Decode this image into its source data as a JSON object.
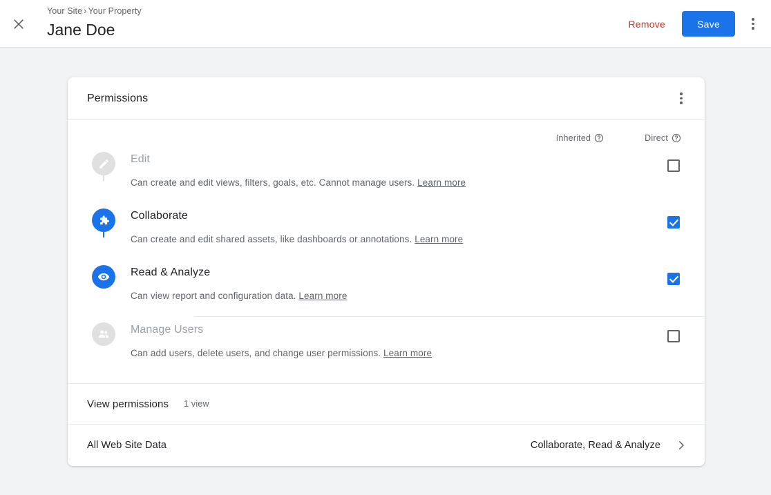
{
  "topbar": {
    "close_icon": "close-icon",
    "breadcrumb": {
      "account": "Your Site",
      "separator": "›",
      "property": "Your Property"
    },
    "title": "Jane Doe",
    "remove_label": "Remove",
    "save_label": "Save",
    "overflow_icon": "more-vert-icon"
  },
  "card": {
    "header_title": "Permissions",
    "header_overflow_icon": "more-vert-icon",
    "columns": [
      {
        "label": "Inherited",
        "help_icon": "help-circle-icon"
      },
      {
        "label": "Direct",
        "help_icon": "help-circle-icon"
      }
    ],
    "permissions": [
      {
        "name": "Edit",
        "icon": "pencil-icon",
        "active": false,
        "description": "Can create and edit views, filters, goals, etc. Cannot manage users.",
        "learn_more": "Learn more",
        "inherited": null,
        "direct": false
      },
      {
        "name": "Collaborate",
        "icon": "puzzle-piece-icon",
        "active": true,
        "description": "Can create and edit shared assets, like dashboards or annotations.",
        "learn_more": "Learn more",
        "inherited": null,
        "direct": true
      },
      {
        "name": "Read & Analyze",
        "icon": "eye-icon",
        "active": true,
        "description": "Can view report and configuration data.",
        "learn_more": "Learn more",
        "inherited": null,
        "direct": true
      },
      {
        "name": "Manage Users",
        "icon": "people-icon",
        "active": false,
        "description": "Can add users, delete users, and change user permissions.",
        "learn_more": "Learn more",
        "inherited": null,
        "direct": false
      }
    ],
    "view_permissions": {
      "title": "View permissions",
      "count": "1 view"
    },
    "views": [
      {
        "name": "All Web Site Data",
        "permissions": "Collaborate, Read & Analyze",
        "chevron_icon": "chevron-right-icon"
      }
    ]
  },
  "colors": {
    "accent": "#1a73e8",
    "danger": "#d93025",
    "page_background": "#f1f3f4",
    "surface": "#ffffff",
    "text_primary": "#202124",
    "text_secondary": "#5f6368",
    "disabled_icon_bg": "#e0e0e0"
  }
}
